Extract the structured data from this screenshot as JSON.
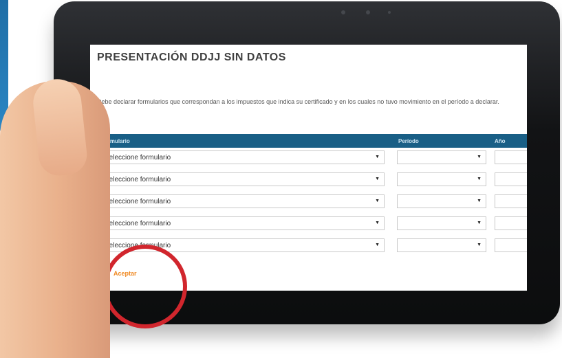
{
  "colors": {
    "bezel": "#121315",
    "table_header": "#195f86",
    "accent_orange": "#f08a24",
    "highlight_red": "#d1262d"
  },
  "page": {
    "title": "PRESENTACIÓN DDJJ SIN DATOS",
    "description": "Debe declarar formularios que correspondan a los impuestos que indica su certificado y en los cuales no tuvo movimiento en el período a declarar."
  },
  "table": {
    "headers": {
      "formulario": "Formulario",
      "periodo": "Período",
      "anio": "Año"
    },
    "rows": [
      {
        "formulario": "Seleccione formulario",
        "periodo": "",
        "anio": ""
      },
      {
        "formulario": "Seleccione formulario",
        "periodo": "",
        "anio": ""
      },
      {
        "formulario": "Seleccione formulario",
        "periodo": "",
        "anio": ""
      },
      {
        "formulario": "Seleccione formulario",
        "periodo": "",
        "anio": ""
      },
      {
        "formulario": "Seleccione formulario",
        "periodo": "",
        "anio": ""
      }
    ]
  },
  "actions": {
    "accept_label": "Aceptar"
  },
  "icons": {
    "dropdown": "dropdown-arrow-icon"
  }
}
